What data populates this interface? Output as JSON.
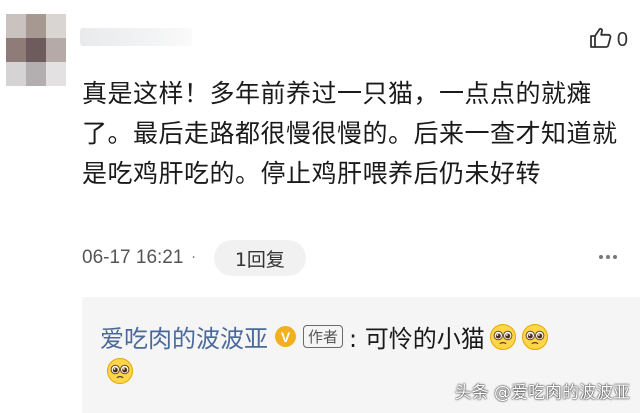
{
  "comment": {
    "text": "真是这样！多年前养过一只猫，一点点的就瘫了。最后走路都很慢很慢的。后来一查才知道就是吃鸡肝吃的。停止鸡肝喂养后仍未好转",
    "timestamp": "06-17 16:21",
    "separator": "·",
    "reply_button": "1回复",
    "like_count": "0",
    "more_icon": "more-dots-icon",
    "like_icon": "thumbs-up-icon"
  },
  "reply": {
    "author": "爱吃肉的波波亚",
    "verified_badge": "V",
    "author_tag": "作者",
    "text": ": 可怜的小猫",
    "emoji": "pleading-face-emoji"
  },
  "watermark": "头条 @爱吃肉的波波亚",
  "colors": {
    "author_link": "#4a6a9a",
    "reply_bg": "#f5f5f5",
    "reply_button_bg": "#f1f1f1",
    "verified": "#f2b01e",
    "text": "#1a1a1a"
  }
}
